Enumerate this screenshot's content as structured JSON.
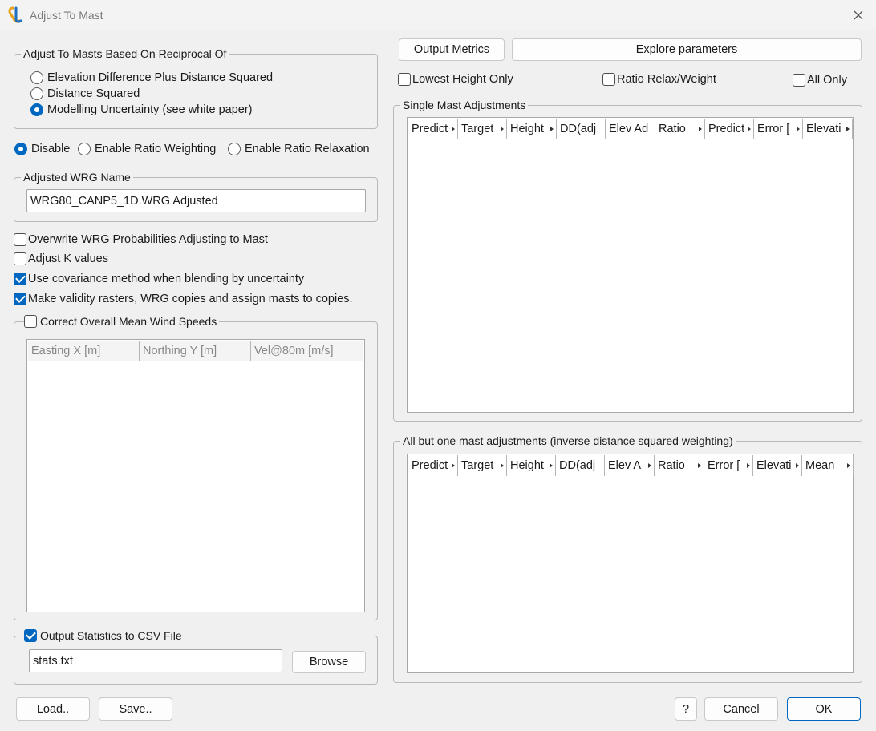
{
  "window": {
    "title": "Adjust To Mast",
    "icon": "app-logo-icon",
    "close_icon": "close-icon"
  },
  "reciprocal_group": {
    "legend": "Adjust To Masts Based On Reciprocal Of",
    "options": [
      {
        "label": "Elevation Difference Plus Distance Squared",
        "selected": false
      },
      {
        "label": "Distance Squared",
        "selected": false
      },
      {
        "label": "Modelling Uncertainty (see white paper)",
        "selected": true
      }
    ]
  },
  "weighting": {
    "options": [
      {
        "label": "Disable",
        "selected": true
      },
      {
        "label": "Enable Ratio Weighting",
        "selected": false
      },
      {
        "label": "Enable Ratio Relaxation",
        "selected": false
      }
    ]
  },
  "adjusted_wrg": {
    "legend": "Adjusted WRG Name",
    "value": "WRG80_CANP5_1D.WRG Adjusted"
  },
  "checkboxes": [
    {
      "label": "Overwrite WRG Probabilities Adjusting to Mast",
      "checked": false
    },
    {
      "label": "Adjust K values",
      "checked": false
    },
    {
      "label": "Use covariance method when blending by uncertainty",
      "checked": true
    },
    {
      "label": "Make validity rasters, WRG copies and assign masts to copies.",
      "checked": true
    }
  ],
  "mean_wind": {
    "legend": "Correct Overall Mean Wind Speeds",
    "checked": false,
    "columns": [
      "Easting X [m]",
      "Northing Y [m]",
      "Vel@80m [m/s]"
    ]
  },
  "csv_output": {
    "legend": "Output Statistics to CSV File",
    "checked": true,
    "file": "stats.txt",
    "browse_label": "Browse"
  },
  "top_buttons": {
    "output_metrics": "Output Metrics",
    "explore": "Explore parameters"
  },
  "right_checks": [
    {
      "label": "Lowest Height Only",
      "checked": false
    },
    {
      "label": "Ratio Relax/Weight",
      "checked": false
    },
    {
      "label": "All Only",
      "checked": false
    }
  ],
  "single_mast": {
    "legend": "Single Mast Adjustments",
    "columns": [
      "Predict",
      "Target",
      "Height",
      "DD(adj",
      "Elev Ad",
      "Ratio",
      "Predict",
      "Error [",
      "Elevati"
    ]
  },
  "all_but_one": {
    "legend": "All but one mast adjustments (inverse distance squared weighting)",
    "columns": [
      "Predict",
      "Target",
      "Height",
      "DD(adj",
      "Elev A",
      "Ratio",
      "Error [",
      "Elevati",
      "Mean"
    ]
  },
  "footer": {
    "load": "Load..",
    "save": "Save..",
    "help": "?",
    "cancel": "Cancel",
    "ok": "OK"
  },
  "colors": {
    "accent": "#0067c0",
    "background": "#f0f0f0"
  }
}
